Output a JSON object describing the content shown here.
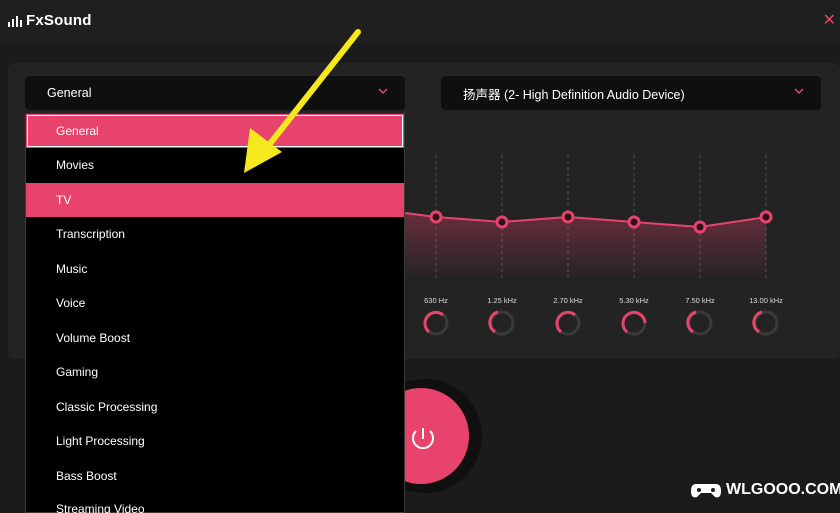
{
  "app": {
    "title": "FxSound"
  },
  "preset_select": {
    "value": "General"
  },
  "device_select": {
    "value": "扬声器 (2- High Definition Audio Device)"
  },
  "preset_menu": {
    "items": [
      {
        "label": "General",
        "state": "selected"
      },
      {
        "label": "Movies",
        "state": "normal"
      },
      {
        "label": "TV",
        "state": "hover"
      },
      {
        "label": "Transcription",
        "state": "normal"
      },
      {
        "label": "Music",
        "state": "normal"
      },
      {
        "label": "Voice",
        "state": "normal"
      },
      {
        "label": "Volume Boost",
        "state": "normal"
      },
      {
        "label": "Gaming",
        "state": "normal"
      },
      {
        "label": "Classic Processing",
        "state": "normal"
      },
      {
        "label": "Light Processing",
        "state": "normal"
      },
      {
        "label": "Bass Boost",
        "state": "normal"
      },
      {
        "label": "Streaming Video",
        "state": "normal"
      }
    ]
  },
  "eq": {
    "bands": [
      "630 Hz",
      "1.25 kHz",
      "2.70 kHz",
      "5.30 kHz",
      "7.50 kHz",
      "13.00 kHz"
    ]
  },
  "watermark": {
    "text": "WLGOOO.COM"
  },
  "colors": {
    "accent": "#e8436d",
    "background": "#1b1b1b",
    "arrow": "#f5e81c"
  }
}
